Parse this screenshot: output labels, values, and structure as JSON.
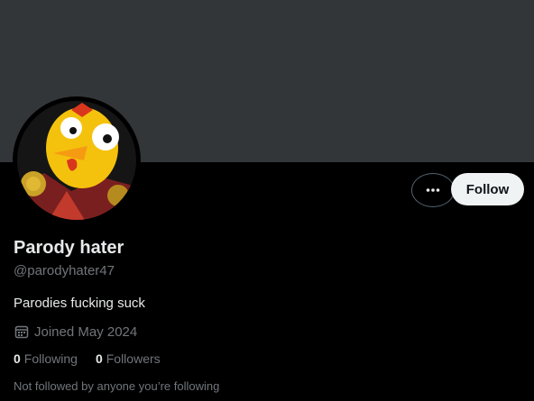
{
  "profile": {
    "display_name": "Parody hater",
    "handle": "@parodyhater47",
    "bio": "Parodies fucking suck",
    "joined": "Joined May 2024",
    "following_count": "0",
    "following_label": "Following",
    "followers_count": "0",
    "followers_label": "Followers",
    "followed_by_note": "Not followed by anyone you’re following"
  },
  "actions": {
    "follow_label": "Follow",
    "more_icon": "more-horizontal-icon"
  },
  "icons": {
    "joined": "calendar-icon"
  },
  "colors": {
    "banner": "#333639",
    "background": "#000000",
    "text_primary": "#e7e9ea",
    "text_secondary": "#71767b",
    "follow_button": "#eff3f4"
  }
}
